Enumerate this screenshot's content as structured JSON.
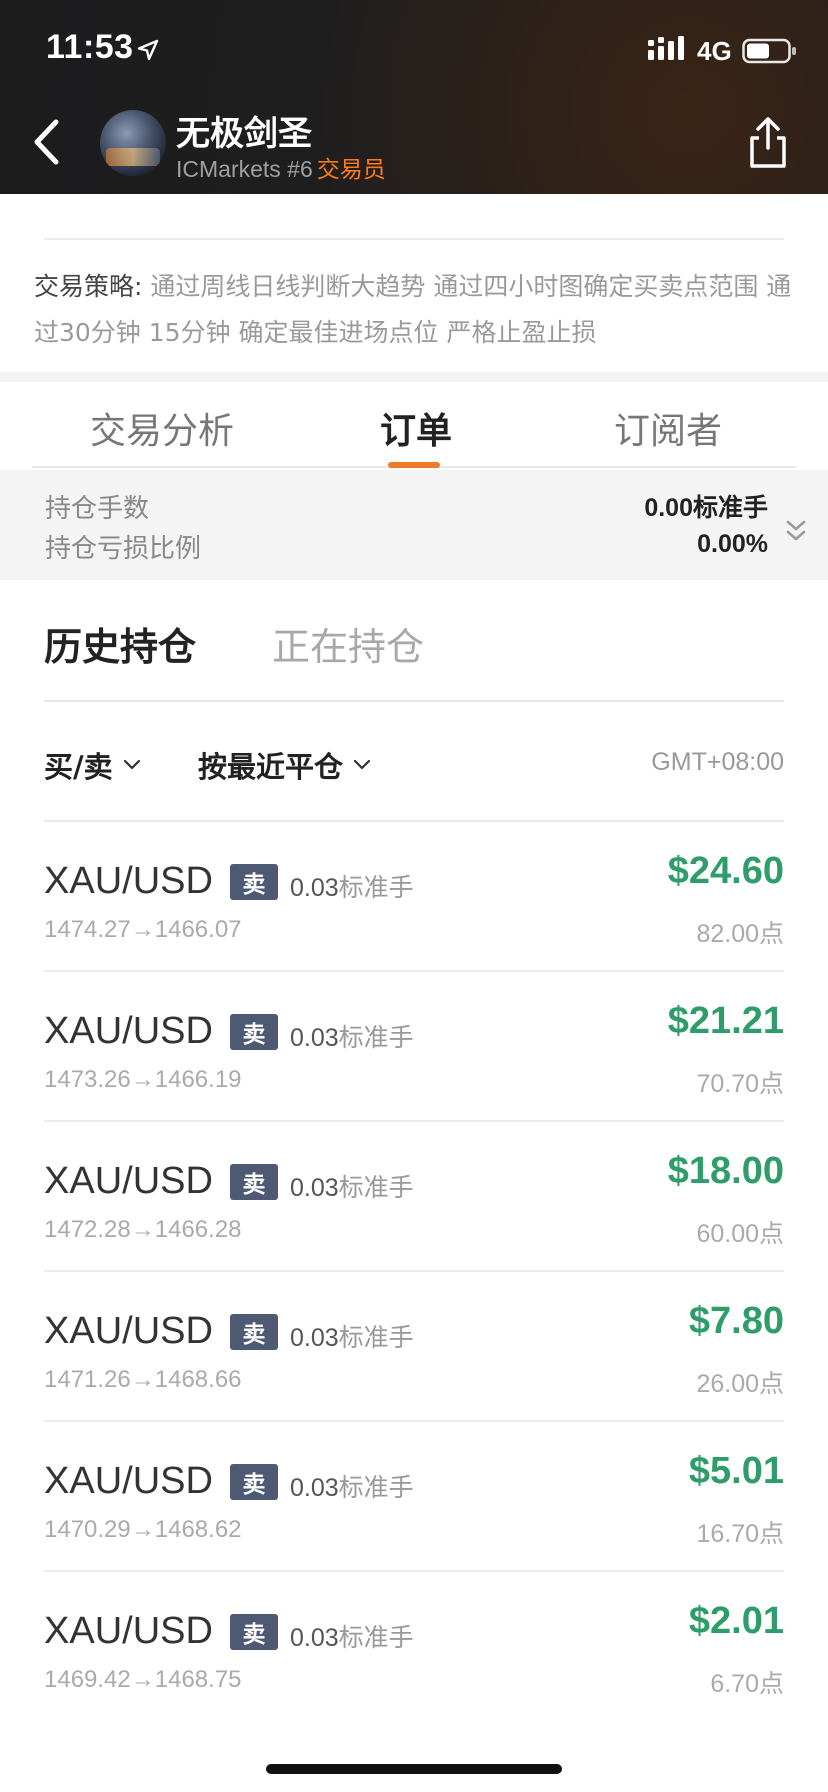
{
  "status_bar": {
    "time": "11:53",
    "network": "4G"
  },
  "header": {
    "title": "无极剑圣",
    "subtitle_broker": "ICMarkets #6",
    "subtitle_role": "交易员"
  },
  "strategy": {
    "label": "交易策略:",
    "text": " 通过周线日线判断大趋势 通过四小时图确定买卖点范围 通过30分钟 15分钟 确定最佳进场点位 严格止盈止损"
  },
  "tabs": [
    {
      "label": "交易分析"
    },
    {
      "label": "订单"
    },
    {
      "label": "订阅者"
    }
  ],
  "summary": {
    "lots_label": "持仓手数",
    "lots_value": "0.00标准手",
    "ratio_label": "持仓亏损比例",
    "ratio_value": "0.00%"
  },
  "subtabs": {
    "history": "历史持仓",
    "open": "正在持仓"
  },
  "filters": {
    "side": "买/卖",
    "sort": "按最近平仓",
    "timezone": "GMT+08:00"
  },
  "orders": [
    {
      "symbol": "XAU/USD",
      "side": "卖",
      "lots": "0.03",
      "unit": "标准手",
      "prices": "1474.27→1466.07",
      "pnl": "$24.60",
      "points": "82.00点"
    },
    {
      "symbol": "XAU/USD",
      "side": "卖",
      "lots": "0.03",
      "unit": "标准手",
      "prices": "1473.26→1466.19",
      "pnl": "$21.21",
      "points": "70.70点"
    },
    {
      "symbol": "XAU/USD",
      "side": "卖",
      "lots": "0.03",
      "unit": "标准手",
      "prices": "1472.28→1466.28",
      "pnl": "$18.00",
      "points": "60.00点"
    },
    {
      "symbol": "XAU/USD",
      "side": "卖",
      "lots": "0.03",
      "unit": "标准手",
      "prices": "1471.26→1468.66",
      "pnl": "$7.80",
      "points": "26.00点"
    },
    {
      "symbol": "XAU/USD",
      "side": "卖",
      "lots": "0.03",
      "unit": "标准手",
      "prices": "1470.29→1468.62",
      "pnl": "$5.01",
      "points": "16.70点"
    },
    {
      "symbol": "XAU/USD",
      "side": "卖",
      "lots": "0.03",
      "unit": "标准手",
      "prices": "1469.42→1468.75",
      "pnl": "$2.01",
      "points": "6.70点"
    }
  ],
  "colors": {
    "accent": "#ee7a2c",
    "profit": "#2e9d6a",
    "sell_badge": "#4e5a74",
    "header_bg": "#1e1e1f"
  }
}
